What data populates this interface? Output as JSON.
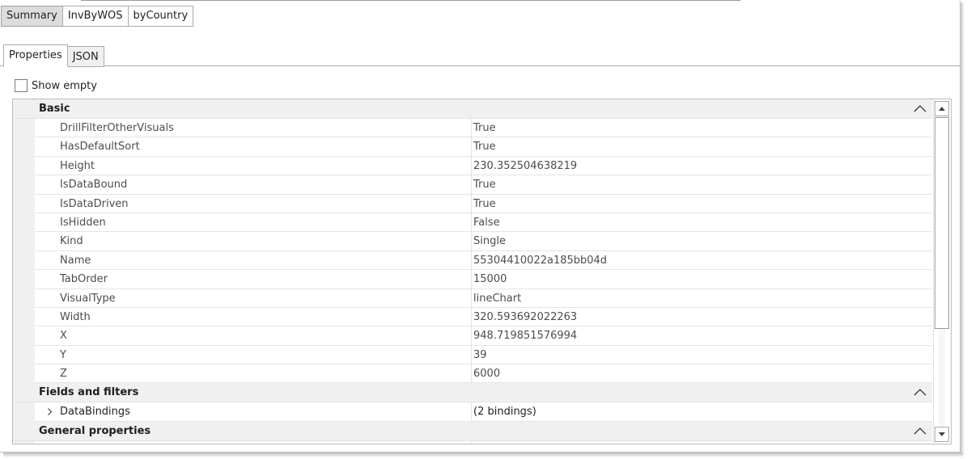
{
  "page_tabs": [
    {
      "label": "Summary",
      "active": true
    },
    {
      "label": "InvByWOS",
      "active": false
    },
    {
      "label": "byCountry",
      "active": false
    }
  ],
  "view_tabs": [
    {
      "label": "Properties",
      "active": true
    },
    {
      "label": "JSON",
      "active": false
    }
  ],
  "show_empty": {
    "label": "Show empty",
    "checked": false
  },
  "categories": [
    {
      "label": "Basic",
      "chevron": "chevron-up-icon",
      "rows": [
        {
          "name": "DrillFilterOtherVisuals",
          "value": "True"
        },
        {
          "name": "HasDefaultSort",
          "value": "True"
        },
        {
          "name": "Height",
          "value": "230.352504638219"
        },
        {
          "name": "IsDataBound",
          "value": "True"
        },
        {
          "name": "IsDataDriven",
          "value": "True"
        },
        {
          "name": "IsHidden",
          "value": "False"
        },
        {
          "name": "Kind",
          "value": "Single"
        },
        {
          "name": "Name",
          "value": "55304410022a185bb04d"
        },
        {
          "name": "TabOrder",
          "value": "15000"
        },
        {
          "name": "VisualType",
          "value": "lineChart"
        },
        {
          "name": "Width",
          "value": "320.593692022263"
        },
        {
          "name": "X",
          "value": "948.719851576994"
        },
        {
          "name": "Y",
          "value": "39"
        },
        {
          "name": "Z",
          "value": "6000"
        }
      ]
    },
    {
      "label": "Fields and filters",
      "chevron": "chevron-up-icon",
      "rows": [
        {
          "name": "DataBindings",
          "value": "(2 bindings)",
          "expandable": true
        }
      ]
    },
    {
      "label": "General properties",
      "chevron": "chevron-up-icon",
      "rows": []
    }
  ]
}
